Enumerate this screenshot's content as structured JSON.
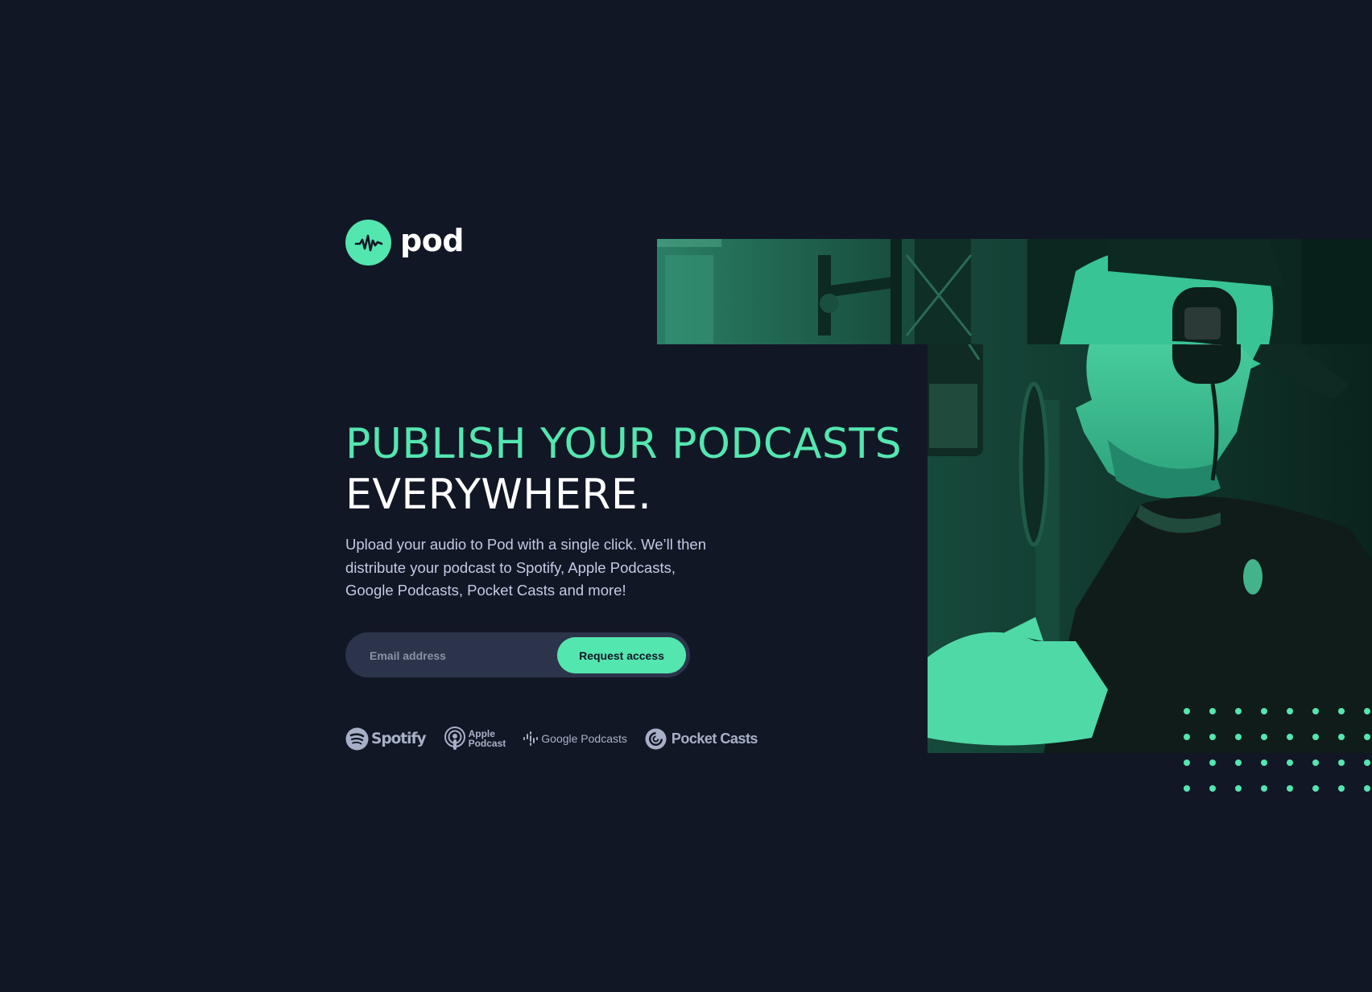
{
  "brand": {
    "name": "pod",
    "logo_icon": "waveform-icon",
    "accent_color": "#54E6AF",
    "background_color": "#121725"
  },
  "hero": {
    "heading_line1": "PUBLISH YOUR PODCASTS",
    "heading_line2": "EVERYWHERE.",
    "description": "Upload your audio to Pod with a single click. We’ll then distribute your podcast to Spotify, Apple Podcasts, Google Podcasts, Pocket Casts and more!",
    "image_description": "podcaster-with-headphones-singing-into-microphone"
  },
  "form": {
    "email_placeholder": "Email address",
    "email_value": "",
    "submit_label": "Request access"
  },
  "platforms": {
    "spotify": {
      "label": "Spotify",
      "icon": "spotify-icon"
    },
    "apple": {
      "line1": "Apple",
      "line2": "Podcast",
      "icon": "apple-podcast-icon"
    },
    "google": {
      "label": "Google Podcasts",
      "icon": "google-podcasts-icon"
    },
    "pocket": {
      "label": "Pocket Casts",
      "icon": "pocket-casts-icon"
    }
  }
}
